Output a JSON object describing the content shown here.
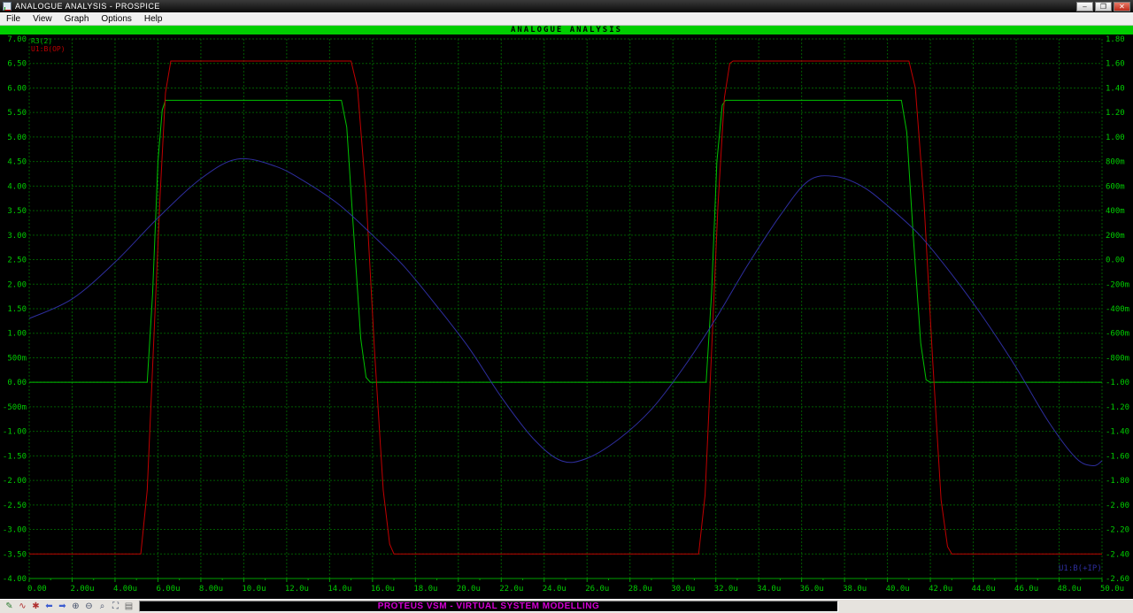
{
  "window": {
    "title": "ANALOGUE ANALYSIS - PROSPICE",
    "menu": [
      "File",
      "View",
      "Graph",
      "Options",
      "Help"
    ],
    "controls": {
      "minimize": "–",
      "maximize": "❐",
      "close": "✕"
    }
  },
  "header": {
    "title": "ANALOGUE ANALYSIS"
  },
  "statusbar": {
    "message": "PROTEUS VSM - VIRTUAL SYSTEM MODELLING",
    "icons": [
      {
        "name": "edit-graph-icon",
        "glyph": "✎",
        "color": "#2e7d32"
      },
      {
        "name": "add-trace-icon",
        "glyph": "∿",
        "color": "#b03030"
      },
      {
        "name": "simulate-graph-icon",
        "glyph": "✱",
        "color": "#b03030"
      },
      {
        "name": "pan-left-icon",
        "glyph": "⬅",
        "color": "#3b5bd0"
      },
      {
        "name": "pan-right-icon",
        "glyph": "➡",
        "color": "#3b5bd0"
      },
      {
        "name": "zoom-in-icon",
        "glyph": "⊕",
        "color": "#44506a"
      },
      {
        "name": "zoom-out-icon",
        "glyph": "⊖",
        "color": "#44506a"
      },
      {
        "name": "zoom-all-icon",
        "glyph": "⌕",
        "color": "#44506a"
      },
      {
        "name": "zoom-area-icon",
        "glyph": "⛶",
        "color": "#44506a"
      },
      {
        "name": "log-icon",
        "glyph": "▤",
        "color": "#666666"
      }
    ]
  },
  "chart_data": {
    "type": "line",
    "title": "ANALOGUE ANALYSIS",
    "grid": true,
    "colors": {
      "background": "#000000",
      "grid": "#005a00",
      "axis_text": "#00cc00"
    },
    "x_axis": {
      "min": 0,
      "max": 50,
      "unit": "µs",
      "tick_step": 2,
      "labels": [
        "0.00",
        "2.00u",
        "4.00u",
        "6.00u",
        "8.00u",
        "10.0u",
        "12.0u",
        "14.0u",
        "16.0u",
        "18.0u",
        "20.0u",
        "22.0u",
        "24.0u",
        "26.0u",
        "28.0u",
        "30.0u",
        "32.0u",
        "34.0u",
        "36.0u",
        "38.0u",
        "40.0u",
        "42.0u",
        "44.0u",
        "46.0u",
        "48.0u",
        "50.0u"
      ]
    },
    "y_axis_left": {
      "min": -4.0,
      "max": 7.0,
      "step": 0.5,
      "labels": [
        "7.00",
        "6.50",
        "6.00",
        "5.50",
        "5.00",
        "4.50",
        "4.00",
        "3.50",
        "3.00",
        "2.50",
        "2.00",
        "1.50",
        "1.00",
        "500m",
        "0.00",
        "-500m",
        "-1.00",
        "-1.50",
        "-2.00",
        "-2.50",
        "-3.00",
        "-3.50",
        "-4.00"
      ]
    },
    "y_axis_right": {
      "min": -2.6,
      "max": 1.8,
      "step": 0.2,
      "labels": [
        "1.80",
        "1.60",
        "1.40",
        "1.20",
        "1.00",
        "800m",
        "600m",
        "400m",
        "200m",
        "0.00",
        "-200m",
        "-400m",
        "-600m",
        "-800m",
        "-1.00",
        "-1.20",
        "-1.40",
        "-1.60",
        "-1.80",
        "-2.00",
        "-2.20",
        "-2.40",
        "-2.60"
      ]
    },
    "legend": {
      "position": "top-left",
      "entries": [
        "R3(2)",
        "U1:B(OP)"
      ]
    },
    "right_trace_label": "U1:B(+IP)",
    "series": [
      {
        "name": "R3(2)",
        "color": "#00c000",
        "axis": "left",
        "smooth": false,
        "points": [
          [
            0,
            0
          ],
          [
            5.5,
            0
          ],
          [
            5.75,
            1.8
          ],
          [
            6.0,
            4.5
          ],
          [
            6.2,
            5.55
          ],
          [
            6.35,
            5.75
          ],
          [
            14.55,
            5.75
          ],
          [
            14.8,
            5.2
          ],
          [
            15.1,
            3.2
          ],
          [
            15.45,
            0.9
          ],
          [
            15.7,
            0.1
          ],
          [
            15.9,
            0
          ],
          [
            31.55,
            0
          ],
          [
            31.8,
            1.8
          ],
          [
            32.05,
            4.5
          ],
          [
            32.3,
            5.65
          ],
          [
            32.45,
            5.75
          ],
          [
            40.65,
            5.75
          ],
          [
            40.9,
            5.1
          ],
          [
            41.2,
            3.0
          ],
          [
            41.55,
            0.8
          ],
          [
            41.8,
            0.05
          ],
          [
            42.0,
            0
          ],
          [
            50,
            0
          ]
        ]
      },
      {
        "name": "U1:B(OP)",
        "color": "#c00000",
        "axis": "left",
        "smooth": false,
        "points": [
          [
            0,
            -3.5
          ],
          [
            5.2,
            -3.5
          ],
          [
            5.5,
            -2.2
          ],
          [
            5.8,
            0.8
          ],
          [
            6.1,
            3.8
          ],
          [
            6.35,
            5.9
          ],
          [
            6.6,
            6.55
          ],
          [
            15.0,
            6.55
          ],
          [
            15.3,
            6.0
          ],
          [
            15.7,
            3.8
          ],
          [
            16.1,
            0.6
          ],
          [
            16.5,
            -2.2
          ],
          [
            16.8,
            -3.3
          ],
          [
            17.0,
            -3.5
          ],
          [
            31.2,
            -3.5
          ],
          [
            31.5,
            -2.3
          ],
          [
            31.8,
            0.6
          ],
          [
            32.1,
            3.6
          ],
          [
            32.4,
            5.8
          ],
          [
            32.65,
            6.5
          ],
          [
            32.8,
            6.55
          ],
          [
            41.0,
            6.55
          ],
          [
            41.3,
            6.0
          ],
          [
            41.7,
            3.7
          ],
          [
            42.1,
            0.5
          ],
          [
            42.5,
            -2.4
          ],
          [
            42.8,
            -3.35
          ],
          [
            43.0,
            -3.5
          ],
          [
            50,
            -3.5
          ]
        ]
      },
      {
        "name": "U1:B(+IP)",
        "color": "#2e2e9e",
        "axis": "left",
        "smooth": true,
        "points": [
          [
            0,
            1.3
          ],
          [
            2,
            1.7
          ],
          [
            4,
            2.45
          ],
          [
            6,
            3.35
          ],
          [
            8,
            4.15
          ],
          [
            9.7,
            4.55
          ],
          [
            11.5,
            4.4
          ],
          [
            13,
            4.05
          ],
          [
            14.5,
            3.6
          ],
          [
            16,
            3.0
          ],
          [
            17.5,
            2.35
          ],
          [
            19,
            1.55
          ],
          [
            20.5,
            0.7
          ],
          [
            22,
            -0.3
          ],
          [
            23.5,
            -1.15
          ],
          [
            24.8,
            -1.6
          ],
          [
            26,
            -1.55
          ],
          [
            27.5,
            -1.15
          ],
          [
            29,
            -0.55
          ],
          [
            30.5,
            0.3
          ],
          [
            32,
            1.3
          ],
          [
            33.5,
            2.4
          ],
          [
            35,
            3.4
          ],
          [
            36.3,
            4.1
          ],
          [
            37.5,
            4.2
          ],
          [
            38.8,
            4.0
          ],
          [
            40,
            3.6
          ],
          [
            41.5,
            3.0
          ],
          [
            43,
            2.2
          ],
          [
            44.5,
            1.3
          ],
          [
            46,
            0.3
          ],
          [
            47.5,
            -0.8
          ],
          [
            48.8,
            -1.55
          ],
          [
            49.6,
            -1.7
          ],
          [
            50,
            -1.6
          ]
        ]
      }
    ]
  }
}
